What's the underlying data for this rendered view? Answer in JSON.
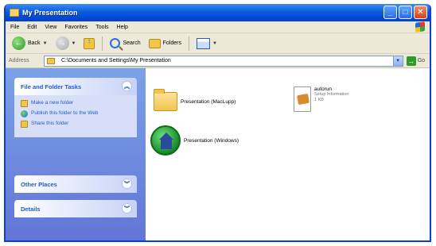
{
  "window": {
    "title": "My Presentation"
  },
  "menu": [
    "File",
    "Edit",
    "View",
    "Favorites",
    "Tools",
    "Help"
  ],
  "toolbar": {
    "back_label": "Back",
    "search_label": "Search",
    "folders_label": "Folders"
  },
  "address": {
    "label": "Address",
    "path": "C:\\Documents and Settings\\My Presentation",
    "go_label": "Go"
  },
  "taskpane": {
    "file_folder_tasks": {
      "title": "File and Folder Tasks",
      "items": [
        "Make a new folder",
        "Publish this folder to the Web",
        "Share this folder"
      ]
    },
    "other_places": {
      "title": "Other Places"
    },
    "details": {
      "title": "Details"
    }
  },
  "files": [
    {
      "name": "Presentation (MacLupp)"
    },
    {
      "name": "Presentation (Windows)"
    },
    {
      "name": "autorun",
      "meta1": "Setup Information",
      "meta2": "1 KB"
    }
  ],
  "colors": {
    "titlebar": "#0a5ce0",
    "taskpane": "#7ba2e7",
    "task_text": "#215dc6"
  }
}
